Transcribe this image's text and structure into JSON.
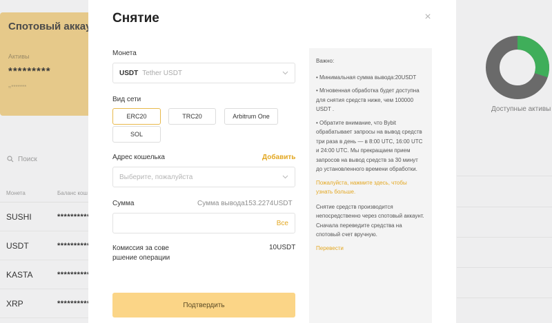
{
  "background": {
    "spot_card": {
      "title": "Спотовый аккау",
      "assets_label": "Активы",
      "balance": "*********",
      "sub": "≈*******"
    },
    "search_placeholder": "Поиск",
    "table": {
      "headers": [
        "Монета",
        "Баланс кош"
      ],
      "rows": [
        {
          "coin": "SUSHI",
          "balance": "**********"
        },
        {
          "coin": "USDT",
          "balance": "**********"
        },
        {
          "coin": "KASTA",
          "balance": "**********"
        },
        {
          "coin": "XRP",
          "balance": "**********"
        }
      ]
    },
    "available_label": "Доступные активы",
    "donut": {
      "green_fraction": 0.3,
      "green": "#3fae5a",
      "gray": "#6a6a6a"
    }
  },
  "modal": {
    "title": "Снятие",
    "close_symbol": "×",
    "coin": {
      "label": "Монета",
      "code": "USDT",
      "name": "Tether USDT"
    },
    "network": {
      "label": "Вид сети",
      "options": [
        "ERC20",
        "TRC20",
        "Arbitrum One",
        "SOL"
      ],
      "selected": "ERC20"
    },
    "address": {
      "label": "Адрес кошелька",
      "add_label": "Добавить",
      "placeholder": "Выберите, пожалуйста"
    },
    "amount": {
      "label": "Сумма",
      "hint": "Сумма вывода153.2274USDT",
      "all_label": "Все"
    },
    "fee": {
      "label": "Комиссия за сове ршение операции",
      "value": "10USDT"
    },
    "confirm_label": "Подтвердить",
    "info": {
      "title": "Важно:",
      "bullets": [
        "• Минимальная сумма вывода:20USDT",
        "• Мгновенная обработка будет доступна для снятия средств ниже, чем 100000 USDT .",
        "• Обратите внимание, что Bybit обрабатывает запросы на вывод средств три раза в день — в 8:00 UTC, 16:00 UTC и 24:00 UTC. Мы прекращаем прием запросов на вывод средств за 30 минут до установленного времени обработки."
      ],
      "link_text": "Пожалуйста, нажмите здесь, чтобы узнать больше.",
      "note": "Снятие средств производится непосредственно через спотовый аккаунт. Сначала переведите средства на спотовый счет вручную.",
      "transfer_link": "Перевести"
    }
  },
  "colors": {
    "accent": "#e3a721",
    "confirm_bg": "#fbd587",
    "spot_card": "#e6c98a"
  }
}
